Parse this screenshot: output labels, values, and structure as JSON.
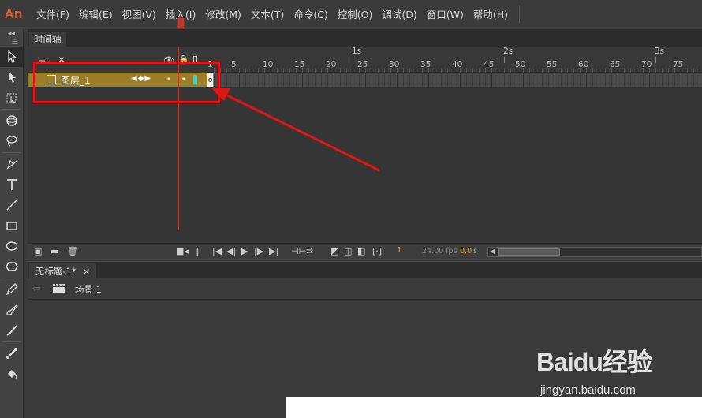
{
  "app": {
    "logo": "An"
  },
  "menu": [
    "文件(F)",
    "编辑(E)",
    "视图(V)",
    "插入(I)",
    "修改(M)",
    "文本(T)",
    "命令(C)",
    "控制(O)",
    "调试(D)",
    "窗口(W)",
    "帮助(H)"
  ],
  "timeline": {
    "tab_label": "时间轴",
    "header_close": "✕",
    "layer": {
      "name": "图层_1",
      "color": "#2fd6d6",
      "row_color": "#9a7e28"
    },
    "seconds": [
      "1s",
      "2s",
      "3s"
    ],
    "frame_numbers": [
      "1",
      "5",
      "10",
      "15",
      "20",
      "25",
      "30",
      "35",
      "40",
      "45",
      "50",
      "55",
      "60",
      "65",
      "70",
      "75"
    ],
    "current_frame": "1",
    "fps": "24.00 fps",
    "time": "0.0",
    "time_unit": "s"
  },
  "document": {
    "tab_label": "无标题-1*",
    "tab_close": "×",
    "scene_label": "场景 1"
  },
  "annotation": {
    "color": "#e01515"
  },
  "watermark": {
    "logo": "Baidu经验",
    "sub": "jingyan.baidu.com"
  }
}
